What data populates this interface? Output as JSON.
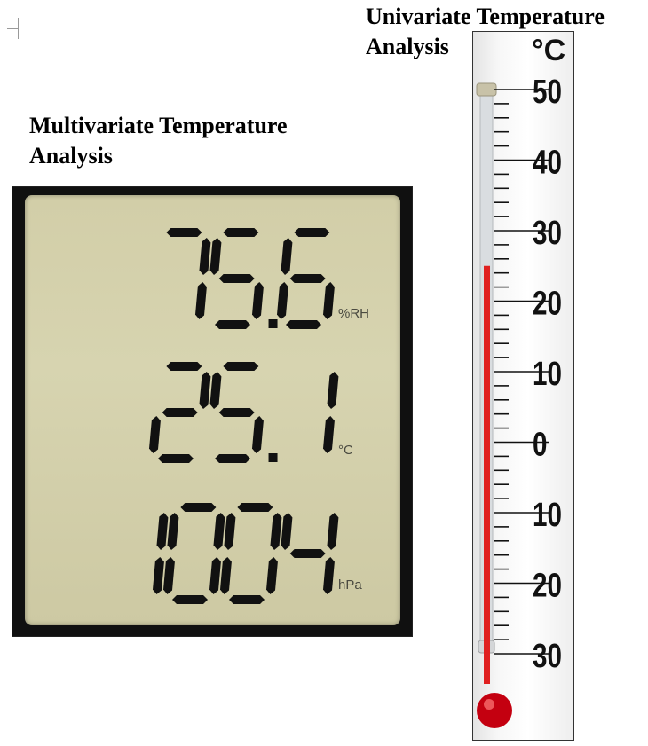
{
  "headings": {
    "univariate": [
      "Univariate Temperature",
      "Analysis"
    ],
    "multivariate": [
      "Multivariate Temperature",
      "Analysis"
    ]
  },
  "lcd_display": {
    "readings": [
      {
        "value": "75.6",
        "unit": "%RH",
        "label": "humidity"
      },
      {
        "value": "25.1",
        "unit": "°C",
        "label": "temperature"
      },
      {
        "value": "1004",
        "unit": "hPa",
        "label": "pressure"
      }
    ],
    "colors": {
      "background": "#d2cea8",
      "segment": "#111111",
      "frame": "#101010"
    }
  },
  "thermometer": {
    "unit_label": "°C",
    "scale_labels": [
      "50",
      "40",
      "30",
      "20",
      "10",
      "0",
      "10",
      "20",
      "30"
    ],
    "scale_values": [
      50,
      40,
      30,
      20,
      10,
      0,
      -10,
      -20,
      -30
    ],
    "current_reading": 25,
    "colors": {
      "liquid": "#e02020",
      "bulb": "#c40010",
      "tick": "#111111"
    }
  }
}
